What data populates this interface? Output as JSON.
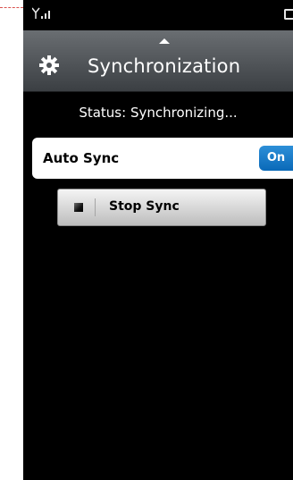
{
  "status_bar": {
    "signal_icon": "signal-strength-icon",
    "battery_icon": "battery-icon"
  },
  "header": {
    "title": "Synchronization",
    "settings_icon": "gear-icon",
    "collapse_icon": "up-arrow-icon"
  },
  "status": {
    "text": "Status: Synchronizing..."
  },
  "auto_sync": {
    "label": "Auto Sync",
    "toggle_value": "On",
    "toggle_color": "#1a7dc9"
  },
  "stop_button": {
    "label": "Stop Sync",
    "icon": "stop-icon"
  }
}
